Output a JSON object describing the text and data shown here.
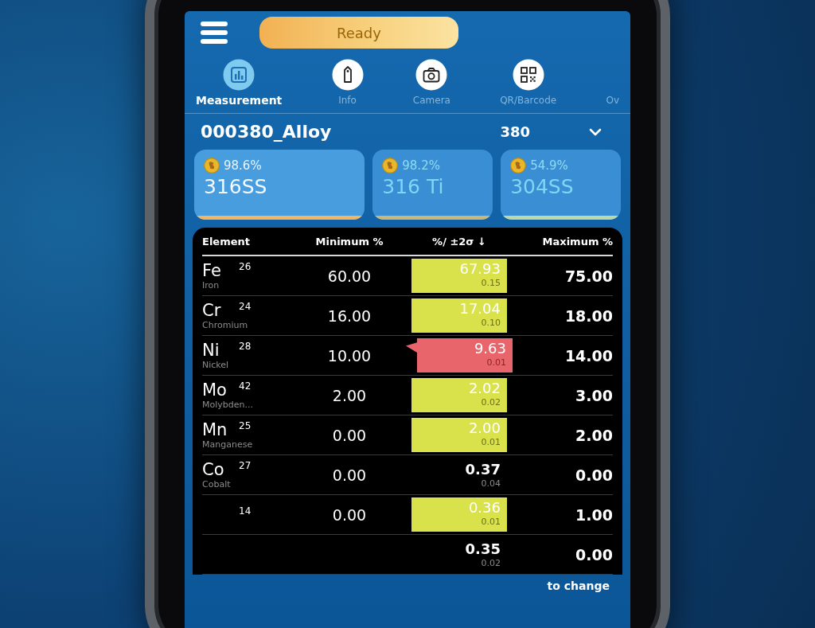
{
  "status": {
    "label": "Ready"
  },
  "tabs": [
    {
      "label": "Measurement",
      "kind": "chart",
      "selected": true
    },
    {
      "label": "Info",
      "kind": "tag",
      "selected": false
    },
    {
      "label": "Camera",
      "kind": "camera",
      "selected": false
    },
    {
      "label": "QR/Barcode",
      "kind": "qr",
      "selected": false
    },
    {
      "label": "Ov",
      "kind": "text",
      "selected": false
    }
  ],
  "measurement": {
    "name": "000380_Alloy",
    "number": "380"
  },
  "matches": [
    {
      "percent": "98.6%",
      "grade": "316SS",
      "selected": true,
      "color": "#f2b562"
    },
    {
      "percent": "98.2%",
      "grade": "316 Ti",
      "selected": false,
      "color": "#c9b77a"
    },
    {
      "percent": "54.9%",
      "grade": "304SS",
      "selected": false,
      "color": "#b9d9a8"
    }
  ],
  "table": {
    "columns": [
      "Element",
      "Minimum %",
      "%/ ±2σ ↓",
      "Maximum %"
    ],
    "rows": [
      {
        "symbol": "Fe",
        "number": "26",
        "name": "Iron",
        "min": "60.00",
        "value": "67.93",
        "sigma": "0.15",
        "kind": "in_range",
        "max": "75.00"
      },
      {
        "symbol": "Cr",
        "number": "24",
        "name": "Chromium",
        "min": "16.00",
        "value": "17.04",
        "sigma": "0.10",
        "kind": "in_range",
        "max": "18.00"
      },
      {
        "symbol": "Ni",
        "number": "28",
        "name": "Nickel",
        "min": "10.00",
        "value": "9.63",
        "sigma": "0.01",
        "kind": "low",
        "max": "14.00"
      },
      {
        "symbol": "Mo",
        "number": "42",
        "name": "Molybden...",
        "min": "2.00",
        "value": "2.02",
        "sigma": "0.02",
        "kind": "in_range",
        "max": "3.00"
      },
      {
        "symbol": "Mn",
        "number": "25",
        "name": "Manganese",
        "min": "0.00",
        "value": "2.00",
        "sigma": "0.01",
        "kind": "in_range",
        "max": "2.00"
      },
      {
        "symbol": "Co",
        "number": "27",
        "name": "Cobalt",
        "min": "0.00",
        "value": "0.37",
        "sigma": "0.04",
        "kind": "plain",
        "max": "0.00"
      },
      {
        "number": "14",
        "min": "0.00",
        "value": "0.36",
        "sigma": "0.01",
        "kind": "in_range",
        "max": "1.00"
      },
      {
        "value": "0.35",
        "sigma": "0.02",
        "kind": "plain",
        "max": "0.00"
      }
    ]
  },
  "hint": {
    "text": "to change"
  }
}
